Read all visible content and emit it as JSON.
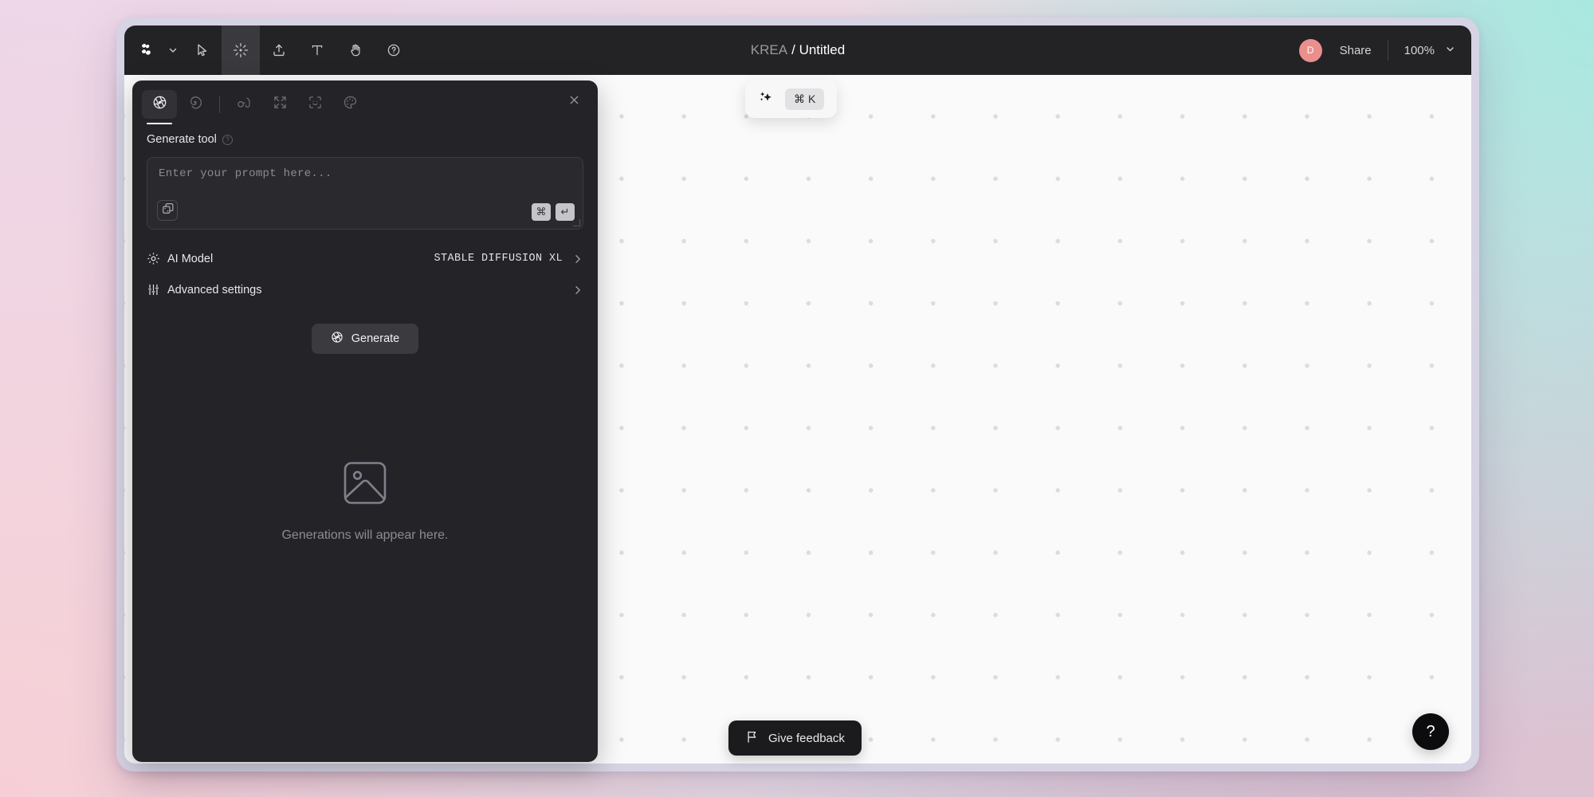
{
  "window": {
    "zoom_level": "100%"
  },
  "topbar": {
    "tools": [
      {
        "name": "krea-logo",
        "label": "KREA"
      },
      {
        "name": "brand-chevron",
        "label": ""
      },
      {
        "name": "select-tool",
        "label": "Select"
      },
      {
        "name": "generate-tool",
        "label": "Generate"
      },
      {
        "name": "upload-tool",
        "label": "Upload"
      },
      {
        "name": "text-tool",
        "label": "Text"
      },
      {
        "name": "hand-tool",
        "label": "Pan"
      },
      {
        "name": "help-tool",
        "label": "Help"
      }
    ],
    "title_brand": "KREA",
    "title_separator": "/",
    "title_document": "Untitled",
    "avatar_initial": "D",
    "avatar_color": "#eb8f8d",
    "share_label": "Share",
    "zoom_label": "100%"
  },
  "command_palette": {
    "icon": "sparkles-icon",
    "shortcut_modifier": "⌘",
    "shortcut_key": "K"
  },
  "panel": {
    "tabs": [
      {
        "name": "tab-generate",
        "icon": "aperture-icon",
        "active": true
      },
      {
        "name": "tab-enhance",
        "icon": "spiral-icon",
        "active": false
      },
      {
        "name": "tab-realtime",
        "icon": "glasses-icon",
        "active": false
      },
      {
        "name": "tab-upscale",
        "icon": "expand-icon",
        "active": false
      },
      {
        "name": "tab-face",
        "icon": "face-scan-icon",
        "active": false
      },
      {
        "name": "tab-style",
        "icon": "palette-icon",
        "active": false
      }
    ],
    "close_label": "×",
    "heading": "Generate tool",
    "heading_info_icon": "question-circle-icon",
    "prompt": {
      "placeholder": "Enter your prompt here...",
      "value": "",
      "randomize_icon": "dice-icon",
      "key_modifier": "⌘",
      "key_enter": "↵"
    },
    "settings": [
      {
        "name": "ai-model",
        "icon": "gear-icon",
        "label": "AI Model",
        "value": "STABLE DIFFUSION XL"
      },
      {
        "name": "advanced-settings",
        "icon": "sliders-icon",
        "label": "Advanced settings",
        "value": ""
      }
    ],
    "generate_button": {
      "label": "Generate",
      "icon": "aperture-icon"
    },
    "empty_state": {
      "icon": "image-placeholder-icon",
      "message": "Generations will appear here."
    }
  },
  "canvas": {
    "dot_color": "#dcdcdc",
    "background_color": "#fafafa"
  },
  "feedback": {
    "icon": "flag-icon",
    "label": "Give feedback"
  },
  "help_fab": {
    "icon": "question-mark-icon",
    "label": "?"
  }
}
